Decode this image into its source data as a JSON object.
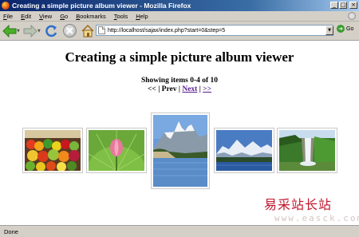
{
  "window": {
    "title": "Creating a simple picture album viewer - Mozilla Firefox",
    "controls": {
      "minimize": "_",
      "maximize": "□",
      "close": "×"
    }
  },
  "menu": {
    "items": [
      {
        "label": "File",
        "accel": "F"
      },
      {
        "label": "Edit",
        "accel": "E"
      },
      {
        "label": "View",
        "accel": "V"
      },
      {
        "label": "Go",
        "accel": "G"
      },
      {
        "label": "Bookmarks",
        "accel": "B"
      },
      {
        "label": "Tools",
        "accel": "T"
      },
      {
        "label": "Help",
        "accel": "H"
      }
    ]
  },
  "toolbar": {
    "url": "http://localhost/sajax/index.php?start=0&step=5",
    "go_label": "Go",
    "icons": [
      "back-icon",
      "forward-icon",
      "reload-icon",
      "stop-icon",
      "home-icon"
    ]
  },
  "page": {
    "title": "Creating a simple picture album viewer",
    "showing": "Showing items 0-4 of 10",
    "pager": {
      "first": "<<",
      "sep1": " | ",
      "prev": "Prev",
      "sep2": " | ",
      "next": "Next",
      "sep3": " | ",
      "last": ">>"
    },
    "thumbnails": [
      {
        "name": "market-produce",
        "selected": false
      },
      {
        "name": "lotus-bud",
        "selected": false
      },
      {
        "name": "mountain-lake",
        "selected": true
      },
      {
        "name": "snowy-mountains",
        "selected": false
      },
      {
        "name": "waterfall",
        "selected": false
      }
    ]
  },
  "status": {
    "text": "Done"
  },
  "watermark": {
    "cn": "易采站长站",
    "url": "www.easck.com"
  },
  "colors": {
    "titlebar": "#0a246a",
    "link_visited": "#551a8b",
    "watermark": "#c0172d"
  }
}
